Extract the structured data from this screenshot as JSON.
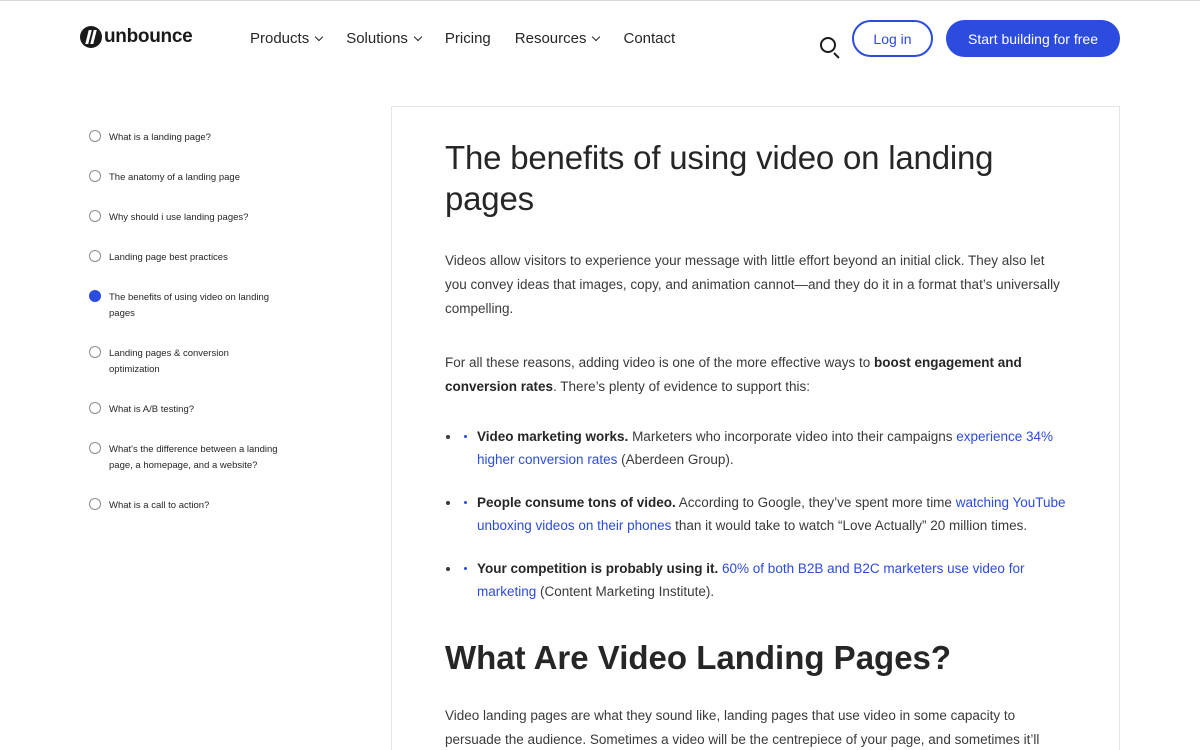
{
  "logo": {
    "text": "unbounce"
  },
  "nav": {
    "items": [
      {
        "label": "Products",
        "dropdown": true
      },
      {
        "label": "Solutions",
        "dropdown": true
      },
      {
        "label": "Pricing",
        "dropdown": false
      },
      {
        "label": "Resources",
        "dropdown": true
      },
      {
        "label": "Contact",
        "dropdown": false
      }
    ]
  },
  "header": {
    "login_label": "Log in",
    "start_label": "Start building for free",
    "search_icon": "search-icon"
  },
  "toc": {
    "items": [
      {
        "label": "What is a landing page?",
        "active": false
      },
      {
        "label": "The anatomy of a landing page",
        "active": false
      },
      {
        "label": "Why should i use landing pages?",
        "active": false
      },
      {
        "label": "Landing page best practices",
        "active": false
      },
      {
        "label": "The benefits of using video on landing pages",
        "active": true
      },
      {
        "label": "Landing pages & conversion optimization",
        "active": false
      },
      {
        "label": "What is A/B testing?",
        "active": false
      },
      {
        "label": "What's the difference between a landing page, a homepage, and a website?",
        "active": false
      },
      {
        "label": "What is a call to action?",
        "active": false
      }
    ]
  },
  "article": {
    "heading1": "The benefits of using video on landing pages",
    "para1": "Videos allow visitors to experience your message with little effort beyond an initial click. They also let you convey ideas that images, copy, and animation cannot—and they do it in a format that’s universally compelling.",
    "para2_pre": "For all these reasons, adding video is one of the more effective ways to ",
    "para2_bold": "boost engagement and conversion rates",
    "para2_post": ". There’s plenty of evidence to support this:",
    "bullets": [
      {
        "bold": "Video marketing works.",
        "pre": " Marketers who incorporate video into their campaigns ",
        "link": "experience 34% higher conversion rates",
        "post": " (Aberdeen Group)."
      },
      {
        "bold": "People consume tons of video.",
        "pre": " According to Google, they’ve spent more time ",
        "link": "watching YouTube unboxing videos on their phones",
        "post": " than it would take to watch “Love Actually” 20 million times."
      },
      {
        "bold": "Your competition is probably using it.",
        "pre": " ",
        "link": "60% of both B2B and B2C marketers use video for marketing",
        "post": " (Content Marketing Institute)."
      }
    ],
    "heading2": "What Are Video Landing Pages?",
    "para3": "Video landing pages are what they sound like, landing pages that use video in some capacity to persuade the audience. Sometimes a video will be the centrepiece of your page, and sometimes it’ll"
  },
  "colors": {
    "accent": "#2c4bdf",
    "text": "#262626"
  }
}
